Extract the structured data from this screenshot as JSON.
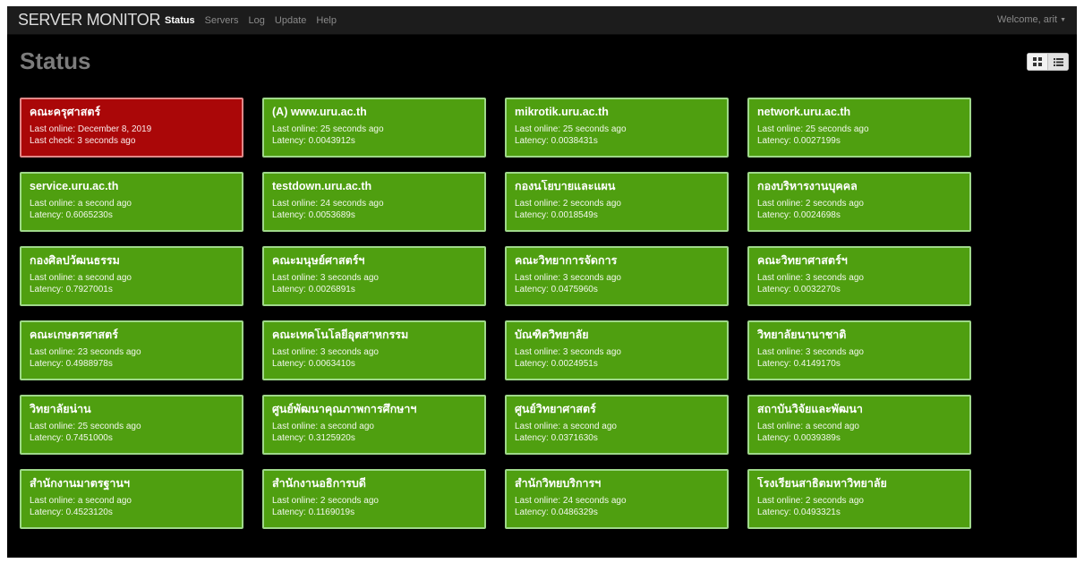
{
  "navbar": {
    "brand": "SERVER MONITOR",
    "items": [
      "Status",
      "Servers",
      "Log",
      "Update",
      "Help"
    ],
    "active": "Status",
    "user": "Welcome, arit"
  },
  "page": {
    "title": "Status"
  },
  "colors": {
    "online": "#4f9f10",
    "offline": "#aa0708",
    "background": "#000000"
  },
  "servers": [
    {
      "name": "คณะครุศาสตร์",
      "status": "down",
      "line1": "Last online: December 8, 2019",
      "line2": "Last check: 3 seconds ago"
    },
    {
      "name": "(A) www.uru.ac.th",
      "status": "up",
      "line1": "Last online: 25 seconds ago",
      "line2": "Latency: 0.0043912s"
    },
    {
      "name": "mikrotik.uru.ac.th",
      "status": "up",
      "line1": "Last online: 25 seconds ago",
      "line2": "Latency: 0.0038431s"
    },
    {
      "name": "network.uru.ac.th",
      "status": "up",
      "line1": "Last online: 25 seconds ago",
      "line2": "Latency: 0.0027199s"
    },
    {
      "name": "service.uru.ac.th",
      "status": "up",
      "line1": "Last online: a second ago",
      "line2": "Latency: 0.6065230s"
    },
    {
      "name": "testdown.uru.ac.th",
      "status": "up",
      "line1": "Last online: 24 seconds ago",
      "line2": "Latency: 0.0053689s"
    },
    {
      "name": "กองนโยบายและแผน",
      "status": "up",
      "line1": "Last online: 2 seconds ago",
      "line2": "Latency: 0.0018549s"
    },
    {
      "name": "กองบริหารงานบุคคล",
      "status": "up",
      "line1": "Last online: 2 seconds ago",
      "line2": "Latency: 0.0024698s"
    },
    {
      "name": "กองศิลปวัฒนธรรม",
      "status": "up",
      "line1": "Last online: a second ago",
      "line2": "Latency: 0.7927001s"
    },
    {
      "name": "คณะมนุษย์ศาสตร์ฯ",
      "status": "up",
      "line1": "Last online: 3 seconds ago",
      "line2": "Latency: 0.0026891s"
    },
    {
      "name": "คณะวิทยาการจัดการ",
      "status": "up",
      "line1": "Last online: 3 seconds ago",
      "line2": "Latency: 0.0475960s"
    },
    {
      "name": "คณะวิทยาศาสตร์ฯ",
      "status": "up",
      "line1": "Last online: 3 seconds ago",
      "line2": "Latency: 0.0032270s"
    },
    {
      "name": "คณะเกษตรศาสตร์",
      "status": "up",
      "line1": "Last online: 23 seconds ago",
      "line2": "Latency: 0.4988978s"
    },
    {
      "name": "คณะเทคโนโลยีอุตสาหกรรม",
      "status": "up",
      "line1": "Last online: 3 seconds ago",
      "line2": "Latency: 0.0063410s"
    },
    {
      "name": "บัณฑิตวิทยาลัย",
      "status": "up",
      "line1": "Last online: 3 seconds ago",
      "line2": "Latency: 0.0024951s"
    },
    {
      "name": "วิทยาลัยนานาชาติ",
      "status": "up",
      "line1": "Last online: 3 seconds ago",
      "line2": "Latency: 0.4149170s"
    },
    {
      "name": "วิทยาลัยน่าน",
      "status": "up",
      "line1": "Last online: 25 seconds ago",
      "line2": "Latency: 0.7451000s"
    },
    {
      "name": "ศูนย์พัฒนาคุณภาพการศึกษาฯ",
      "status": "up",
      "line1": "Last online: a second ago",
      "line2": "Latency: 0.3125920s"
    },
    {
      "name": "ศูนย์วิทยาศาสตร์",
      "status": "up",
      "line1": "Last online: a second ago",
      "line2": "Latency: 0.0371630s"
    },
    {
      "name": "สถาบันวิจัยและพัฒนา",
      "status": "up",
      "line1": "Last online: a second ago",
      "line2": "Latency: 0.0039389s"
    },
    {
      "name": "สำนักงานมาตรฐานฯ",
      "status": "up",
      "line1": "Last online: a second ago",
      "line2": "Latency: 0.4523120s"
    },
    {
      "name": "สำนักงานอธิการบดี",
      "status": "up",
      "line1": "Last online: 2 seconds ago",
      "line2": "Latency: 0.1169019s"
    },
    {
      "name": "สำนักวิทยบริการฯ",
      "status": "up",
      "line1": "Last online: 24 seconds ago",
      "line2": "Latency: 0.0486329s"
    },
    {
      "name": "โรงเรียนสาธิตมหาวิทยาลัย",
      "status": "up",
      "line1": "Last online: 2 seconds ago",
      "line2": "Latency: 0.0493321s"
    }
  ]
}
